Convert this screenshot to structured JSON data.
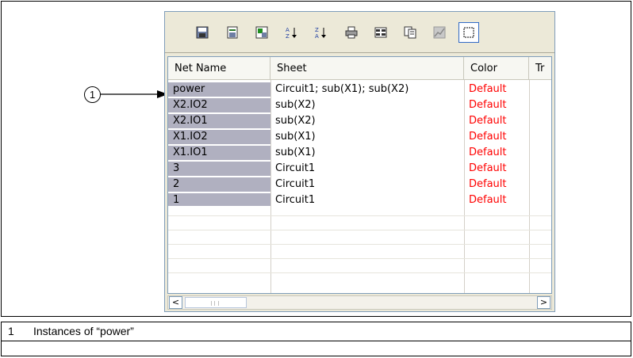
{
  "toolbar": {
    "buttons": [
      {
        "icon": "save-icon"
      },
      {
        "icon": "save-as-icon"
      },
      {
        "icon": "export-excel-icon"
      },
      {
        "icon": "sort-ascending-icon"
      },
      {
        "icon": "sort-descending-icon"
      },
      {
        "icon": "print-icon"
      },
      {
        "icon": "columns-icon"
      },
      {
        "icon": "copy-icon"
      },
      {
        "icon": "graph-icon"
      },
      {
        "icon": "select-all-icon"
      }
    ]
  },
  "table": {
    "headers": [
      "Net Name",
      "Sheet",
      "Color",
      "Tr"
    ],
    "rows": [
      {
        "name": "power",
        "sheet": "Circuit1; sub(X1); sub(X2)",
        "color": "Default"
      },
      {
        "name": "X2.IO2",
        "sheet": "sub(X2)",
        "color": "Default"
      },
      {
        "name": "X2.IO1",
        "sheet": "sub(X2)",
        "color": "Default"
      },
      {
        "name": "X1.IO2",
        "sheet": "sub(X1)",
        "color": "Default"
      },
      {
        "name": "X1.IO1",
        "sheet": "sub(X1)",
        "color": "Default"
      },
      {
        "name": "3",
        "sheet": "Circuit1",
        "color": "Default"
      },
      {
        "name": "2",
        "sheet": "Circuit1",
        "color": "Default"
      },
      {
        "name": "1",
        "sheet": "Circuit1",
        "color": "Default"
      }
    ]
  },
  "scrollbar": {
    "left_arrow": "<",
    "right_arrow": ">"
  },
  "callout": {
    "number": "1"
  },
  "caption": {
    "number": "1",
    "text": "Instances of “power”"
  },
  "colors": {
    "default_text": "#ff0000",
    "selected_bg": "#b0b0c0",
    "window_bg": "#ece9d8"
  }
}
